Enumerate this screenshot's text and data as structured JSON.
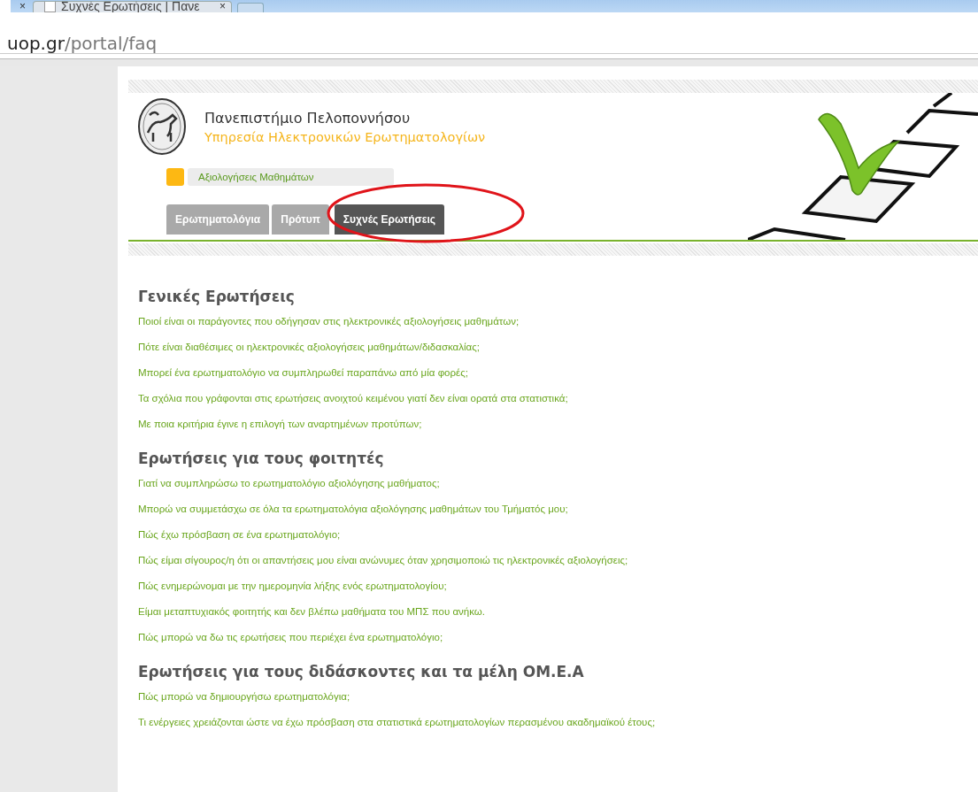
{
  "browser": {
    "close_glyphs": [
      "×",
      "×"
    ],
    "tab_title": "Συχνές Ερωτήσεις | Πανε",
    "address_host": "uop.gr",
    "address_path": "/portal/faq"
  },
  "header": {
    "title": "Πανεπιστήμιο Πελοποννήσου",
    "subtitle": "Υπηρεσία Ηλεκτρονικών Ερωτηματολογίων",
    "breadcrumb": "Αξιολογήσεις Μαθημάτων"
  },
  "tabs": [
    {
      "label": "Ερωτηματολόγια",
      "selected": false
    },
    {
      "label": "Πρότυπ",
      "selected": false
    },
    {
      "label": "Συχνές Ερωτήσεις",
      "selected": true
    }
  ],
  "sections": [
    {
      "heading": "Γενικές Ερωτήσεις",
      "questions": [
        "Ποιοί είναι οι παράγοντες που οδήγησαν στις ηλεκτρονικές αξιολογήσεις μαθημάτων;",
        "Πότε είναι διαθέσιμες οι ηλεκτρονικές αξιολογήσεις μαθημάτων/διδασκαλίας;",
        "Μπορεί ένα ερωτηματολόγιο να συμπληρωθεί παραπάνω από μία φορές;",
        "Τα σχόλια που γράφονται στις ερωτήσεις ανοιχτού κειμένου γιατί δεν είναι ορατά στα στατιστικά;",
        "Με ποια κριτήρια έγινε η επιλογή των αναρτημένων προτύπων;"
      ]
    },
    {
      "heading": "Ερωτήσεις για τους φοιτητές",
      "questions": [
        "Γιατί να συμπληρώσω το ερωτηματολόγιο αξιολόγησης μαθήματος;",
        "Μπορώ να συμμετάσχω σε όλα τα ερωτηματολόγια αξιολόγησης μαθημάτων του Τμήματός μου;",
        "Πώς έχω πρόσβαση σε ένα ερωτηματολόγιο;",
        "Πώς είμαι σίγουρος/η ότι οι απαντήσεις μου είναι ανώνυμες όταν χρησιμοποιώ τις ηλεκτρονικές αξιολογήσεις;",
        "Πώς ενημερώνομαι με την ημερομηνία λήξης ενός ερωτηματολογίου;",
        "Είμαι μεταπτυχιακός φοιτητής και δεν βλέπω μαθήματα του ΜΠΣ που ανήκω.",
        "Πώς μπορώ να δω τις ερωτήσεις που περιέχει ένα ερωτηματολόγιο;"
      ]
    },
    {
      "heading": "Ερωτήσεις για τους διδάσκοντες και τα μέλη ΟΜ.Ε.Α",
      "questions": [
        "Πώς μπορώ να δημιουργήσω ερωτηματολόγια;",
        "Τι ενέργειες χρειάζονται ώστε να έχω πρόσβαση στα στατιστικά ερωτηματολογίων περασμένου ακαδημαϊκού έτους;"
      ]
    }
  ]
}
